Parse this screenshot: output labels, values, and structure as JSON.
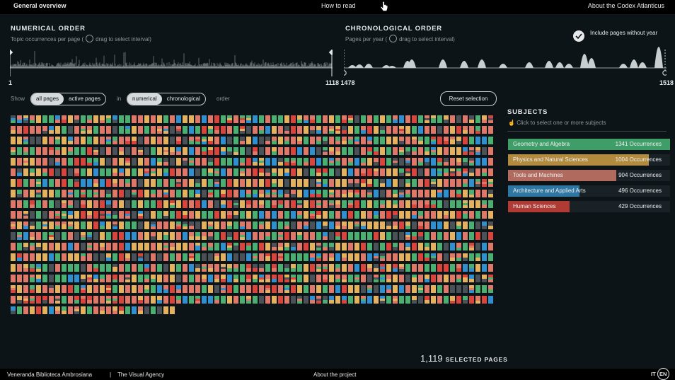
{
  "nav": {
    "title": "General overview",
    "how_to_read": "How to read",
    "about_codex": "About the Codex Atlanticus"
  },
  "numerical": {
    "title": "NUMERICAL ORDER",
    "subtitle_prefix": "Topic occurrences per page (",
    "subtitle_suffix": "drag to select interval)",
    "start_label": "1",
    "end_label": "1118 1478"
  },
  "chronological": {
    "title": "CHRONOLOGICAL ORDER",
    "subtitle_prefix": "Pages per year (",
    "subtitle_suffix": "drag to select interval)",
    "end_label": "1518",
    "include_label": "Include pages without year",
    "include_checked": true
  },
  "controls": {
    "show_label": "Show",
    "all_pages": "all pages",
    "active_pages": "active pages",
    "in_label": "in",
    "numerical": "numerical",
    "chronological": "chronological",
    "order_label": "order",
    "reset": "Reset selection"
  },
  "subjects": {
    "title": "SUBJECTS",
    "hint": "Click to select one or more subjects",
    "items": [
      {
        "name": "Geometry and Algebra",
        "occurrences": "1341 Occurrences",
        "fraction": 1.0,
        "color": "#3f9e68"
      },
      {
        "name": "Physics and Natural Sciences",
        "occurrences": "1004 Occurrences",
        "fraction": 0.87,
        "color": "#b38b3f"
      },
      {
        "name": "Tools and Machines",
        "occurrences": "904 Occurrences",
        "fraction": 0.67,
        "color": "#b06a5e"
      },
      {
        "name": "Architecture and Applied Arts",
        "occurrences": "496 Occurrences",
        "fraction": 0.44,
        "color": "#2e77a3"
      },
      {
        "name": "Human Sciences",
        "occurrences": "429 Occurrences",
        "fraction": 0.38,
        "color": "#b03a34"
      }
    ]
  },
  "selection": {
    "count": "1,119",
    "label": "SELECTED PAGES"
  },
  "footer": {
    "library": "Veneranda Biblioteca Ambrosiana",
    "sep": "|",
    "agency": "The Visual Agency",
    "about_project": "About the project",
    "lang_it": "IT",
    "lang_en": "EN"
  },
  "colors": {
    "geometry": "#4caf72",
    "physics": "#e4b15e",
    "tools": "#e0786a",
    "architecture": "#2f8fcf",
    "human": "#d9453d",
    "none": "#4a5257"
  }
}
